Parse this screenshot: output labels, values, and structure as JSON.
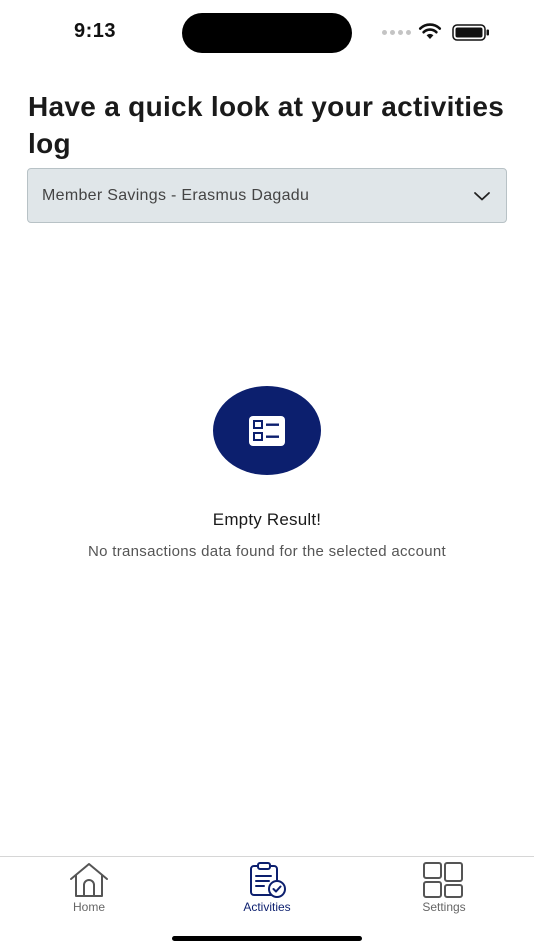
{
  "status_bar": {
    "time": "9:13"
  },
  "header": {
    "title": "Have a quick look at your activities log"
  },
  "account_select": {
    "selected": "Member Savings - Erasmus Dagadu",
    "icon": "chevron-down-icon"
  },
  "empty_state": {
    "icon": "list-icon",
    "icon_bg_color": "#0c1f6e",
    "title": "Empty Result!",
    "message": "No transactions data found for the selected account"
  },
  "tab_bar": {
    "active_color": "#0c1f6e",
    "tabs": [
      {
        "label": "Home",
        "icon": "home-icon",
        "active": false
      },
      {
        "label": "Activities",
        "icon": "clipboard-check-icon",
        "active": true
      },
      {
        "label": "Settings",
        "icon": "grid-icon",
        "active": false
      }
    ]
  }
}
